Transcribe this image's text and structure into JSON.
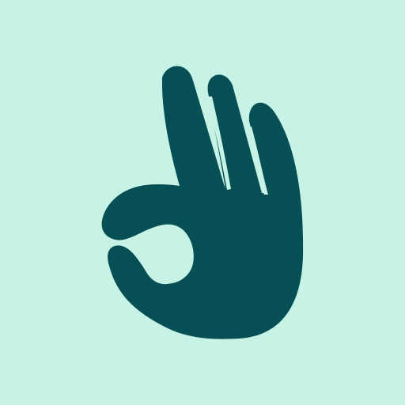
{
  "icon": {
    "name": "ok-hand-icon",
    "colors": {
      "background": "#c7f2e6",
      "hand": "#054f55"
    }
  }
}
